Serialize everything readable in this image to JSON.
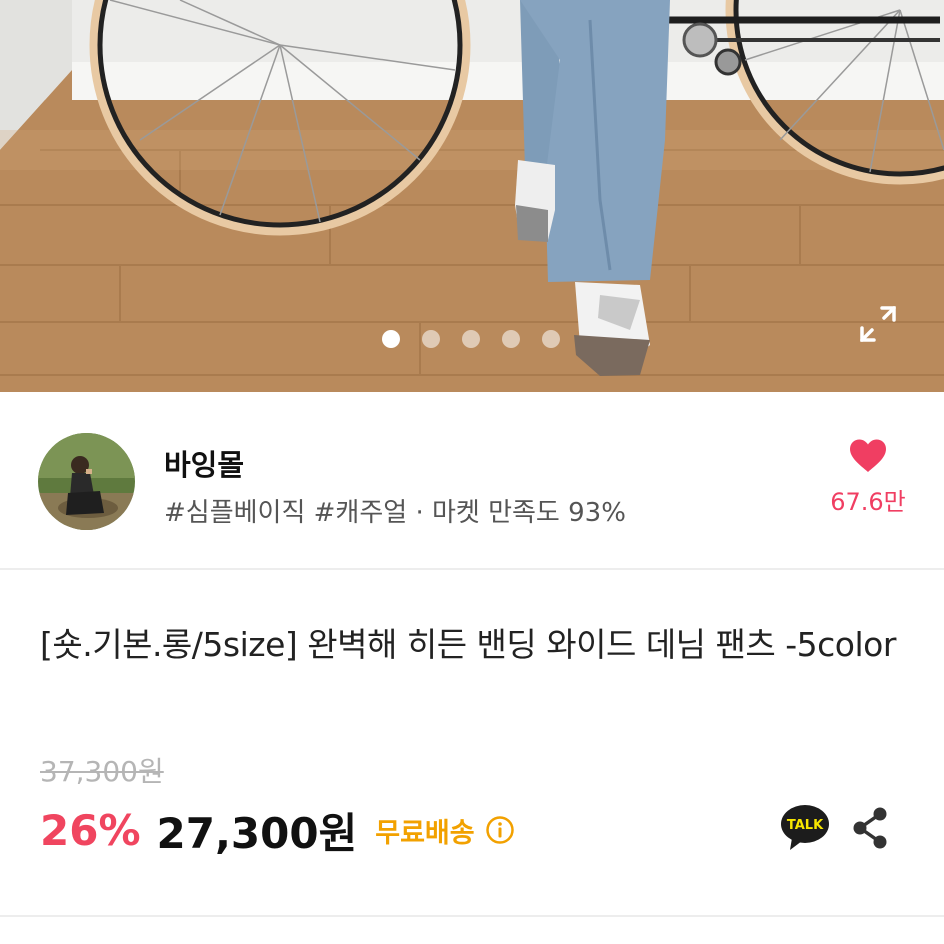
{
  "gallery": {
    "image_alt": "product photo",
    "dot_count": 5,
    "active_index": 0,
    "expand_icon": "expand-icon"
  },
  "shop": {
    "name": "바잉몰",
    "tags_and_rating": "#심플베이직 #캐주얼 · 마켓 만족도 93%",
    "like_count": "67.6만",
    "like_icon": "heart-icon",
    "like_color": "#f03e62"
  },
  "product": {
    "title": "[숏.기본.롱/5size] 완벽해 히든 밴딩 와이드 데님 팬츠 -5color"
  },
  "price": {
    "original": "37,300원",
    "discount": "26%",
    "sale": "27,300원",
    "shipping": "무료배송",
    "discount_color": "#f0455f",
    "shipping_color": "#f2a100"
  },
  "actions": {
    "talk_label": "TALK",
    "talk_icon": "kakao-talk-icon",
    "share_icon": "share-icon"
  }
}
